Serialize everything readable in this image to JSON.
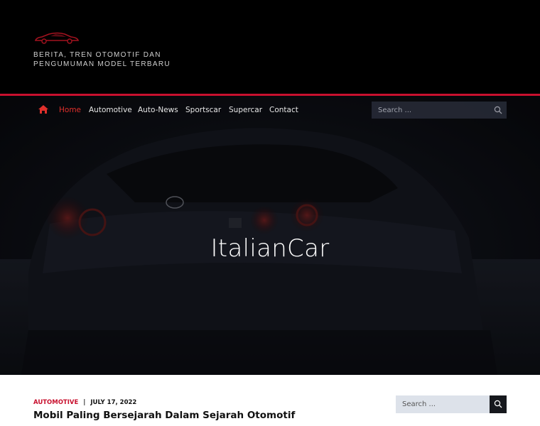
{
  "site": {
    "tagline": "BERITA, TREN OTOMOTIF DAN PENGUMUMAN MODEL TERBARU"
  },
  "nav": {
    "items": [
      {
        "label": "Home",
        "active": true
      },
      {
        "label": "Automotive"
      },
      {
        "label": "Auto-News"
      },
      {
        "label": "Sportscar"
      },
      {
        "label": "Supercar"
      },
      {
        "label": "Contact"
      }
    ],
    "search_placeholder": "Search ..."
  },
  "hero": {
    "title": "ItalianCar"
  },
  "post": {
    "category": "AUTOMOTIVE",
    "separator": "|",
    "date": "JULY 17, 2022",
    "title": "Mobil Paling Bersejarah Dalam Sejarah Otomotif"
  },
  "sidebar": {
    "search_placeholder": "Search ..."
  },
  "colors": {
    "accent": "#c8102e",
    "header_bg": "#000000"
  },
  "icons": [
    "car-logo-icon",
    "home-icon",
    "search-icon"
  ]
}
